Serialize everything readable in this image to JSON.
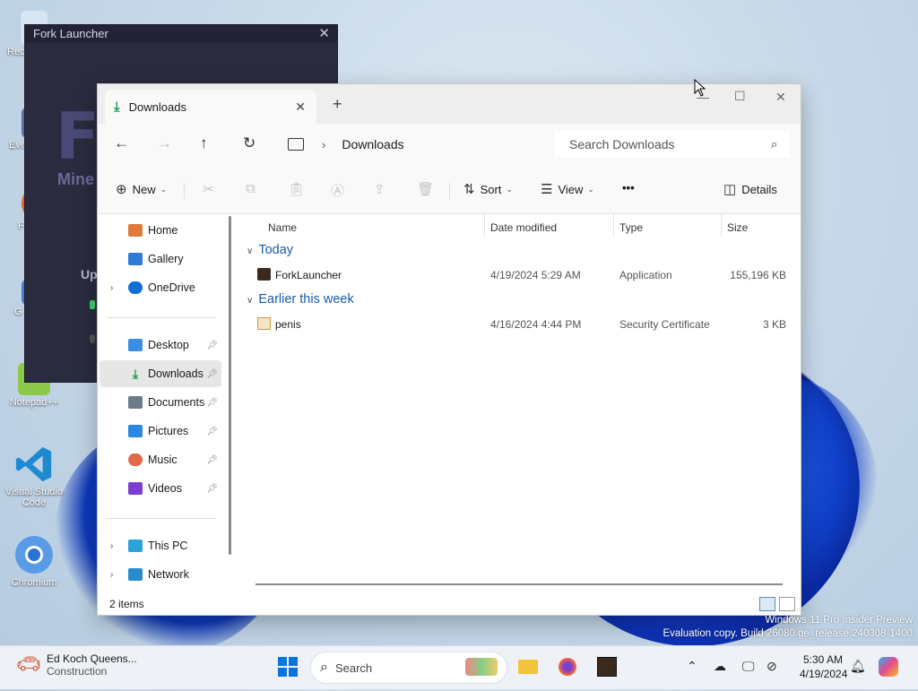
{
  "desktop": {
    "icons": [
      {
        "label": "Rec",
        "icon": "recycle-bin-icon"
      },
      {
        "label": "Eve",
        "icon": "shortcut-icon"
      },
      {
        "label": "F",
        "icon": "firefox-icon"
      },
      {
        "label": "G",
        "icon": "shortcut-icon"
      },
      {
        "label": "Notepad++",
        "icon": "notepadpp-icon"
      },
      {
        "label": "Visual Studio Code",
        "icon": "vscode-icon"
      },
      {
        "label": "Chromium",
        "icon": "chromium-icon"
      }
    ],
    "watermark_line1": "Windows 11 Pro Insider Preview",
    "watermark_line2": "Evaluation copy. Build 26080.ge_release.240308-1400"
  },
  "fork_launcher": {
    "title": "Fork Launcher",
    "logo_text": "F",
    "brand_text": "Mine",
    "status_text": "Up"
  },
  "explorer": {
    "tab_label": "Downloads",
    "address": {
      "crumb": "Downloads"
    },
    "search": {
      "placeholder": "Search Downloads"
    },
    "toolbar": {
      "new_label": "New",
      "sort_label": "Sort",
      "view_label": "View",
      "more_label": "•••",
      "details_label": "Details"
    },
    "nav": {
      "items": [
        {
          "label": "Home",
          "icon": "home-icon",
          "color": "#e07a3a"
        },
        {
          "label": "Gallery",
          "icon": "gallery-icon",
          "color": "#2f7ad6"
        },
        {
          "label": "OneDrive",
          "icon": "onedrive-icon",
          "color": "#0e6fd6"
        },
        {
          "label": "Desktop",
          "icon": "desktop-icon",
          "color": "#3a8ee6"
        },
        {
          "label": "Downloads",
          "icon": "download-icon",
          "color": "#179c52"
        },
        {
          "label": "Documents",
          "icon": "documents-icon",
          "color": "#6c7a8a"
        },
        {
          "label": "Pictures",
          "icon": "pictures-icon",
          "color": "#2a88e0"
        },
        {
          "label": "Music",
          "icon": "music-icon",
          "color": "#e06a4a"
        },
        {
          "label": "Videos",
          "icon": "videos-icon",
          "color": "#7a3fd0"
        },
        {
          "label": "This PC",
          "icon": "this-pc-icon",
          "color": "#2aa4d8"
        },
        {
          "label": "Network",
          "icon": "network-icon",
          "color": "#2a8ad0"
        }
      ]
    },
    "columns": [
      "Name",
      "Date modified",
      "Type",
      "Size"
    ],
    "groups": [
      {
        "label": "Today",
        "files": [
          {
            "name": "ForkLauncher",
            "date": "4/19/2024 5:29 AM",
            "type": "Application",
            "size": "155,196 KB",
            "icon": "application-icon"
          }
        ]
      },
      {
        "label": "Earlier this week",
        "files": [
          {
            "name": "penis",
            "date": "4/16/2024 4:44 PM",
            "type": "Security Certificate",
            "size": "3 KB",
            "icon": "certificate-icon"
          }
        ]
      }
    ],
    "status": {
      "item_count": "2 items"
    }
  },
  "taskbar": {
    "weather_title": "Ed Koch Queens...",
    "weather_sub": "Construction",
    "search_label": "Search",
    "time": "5:30 AM",
    "date": "4/19/2024"
  }
}
